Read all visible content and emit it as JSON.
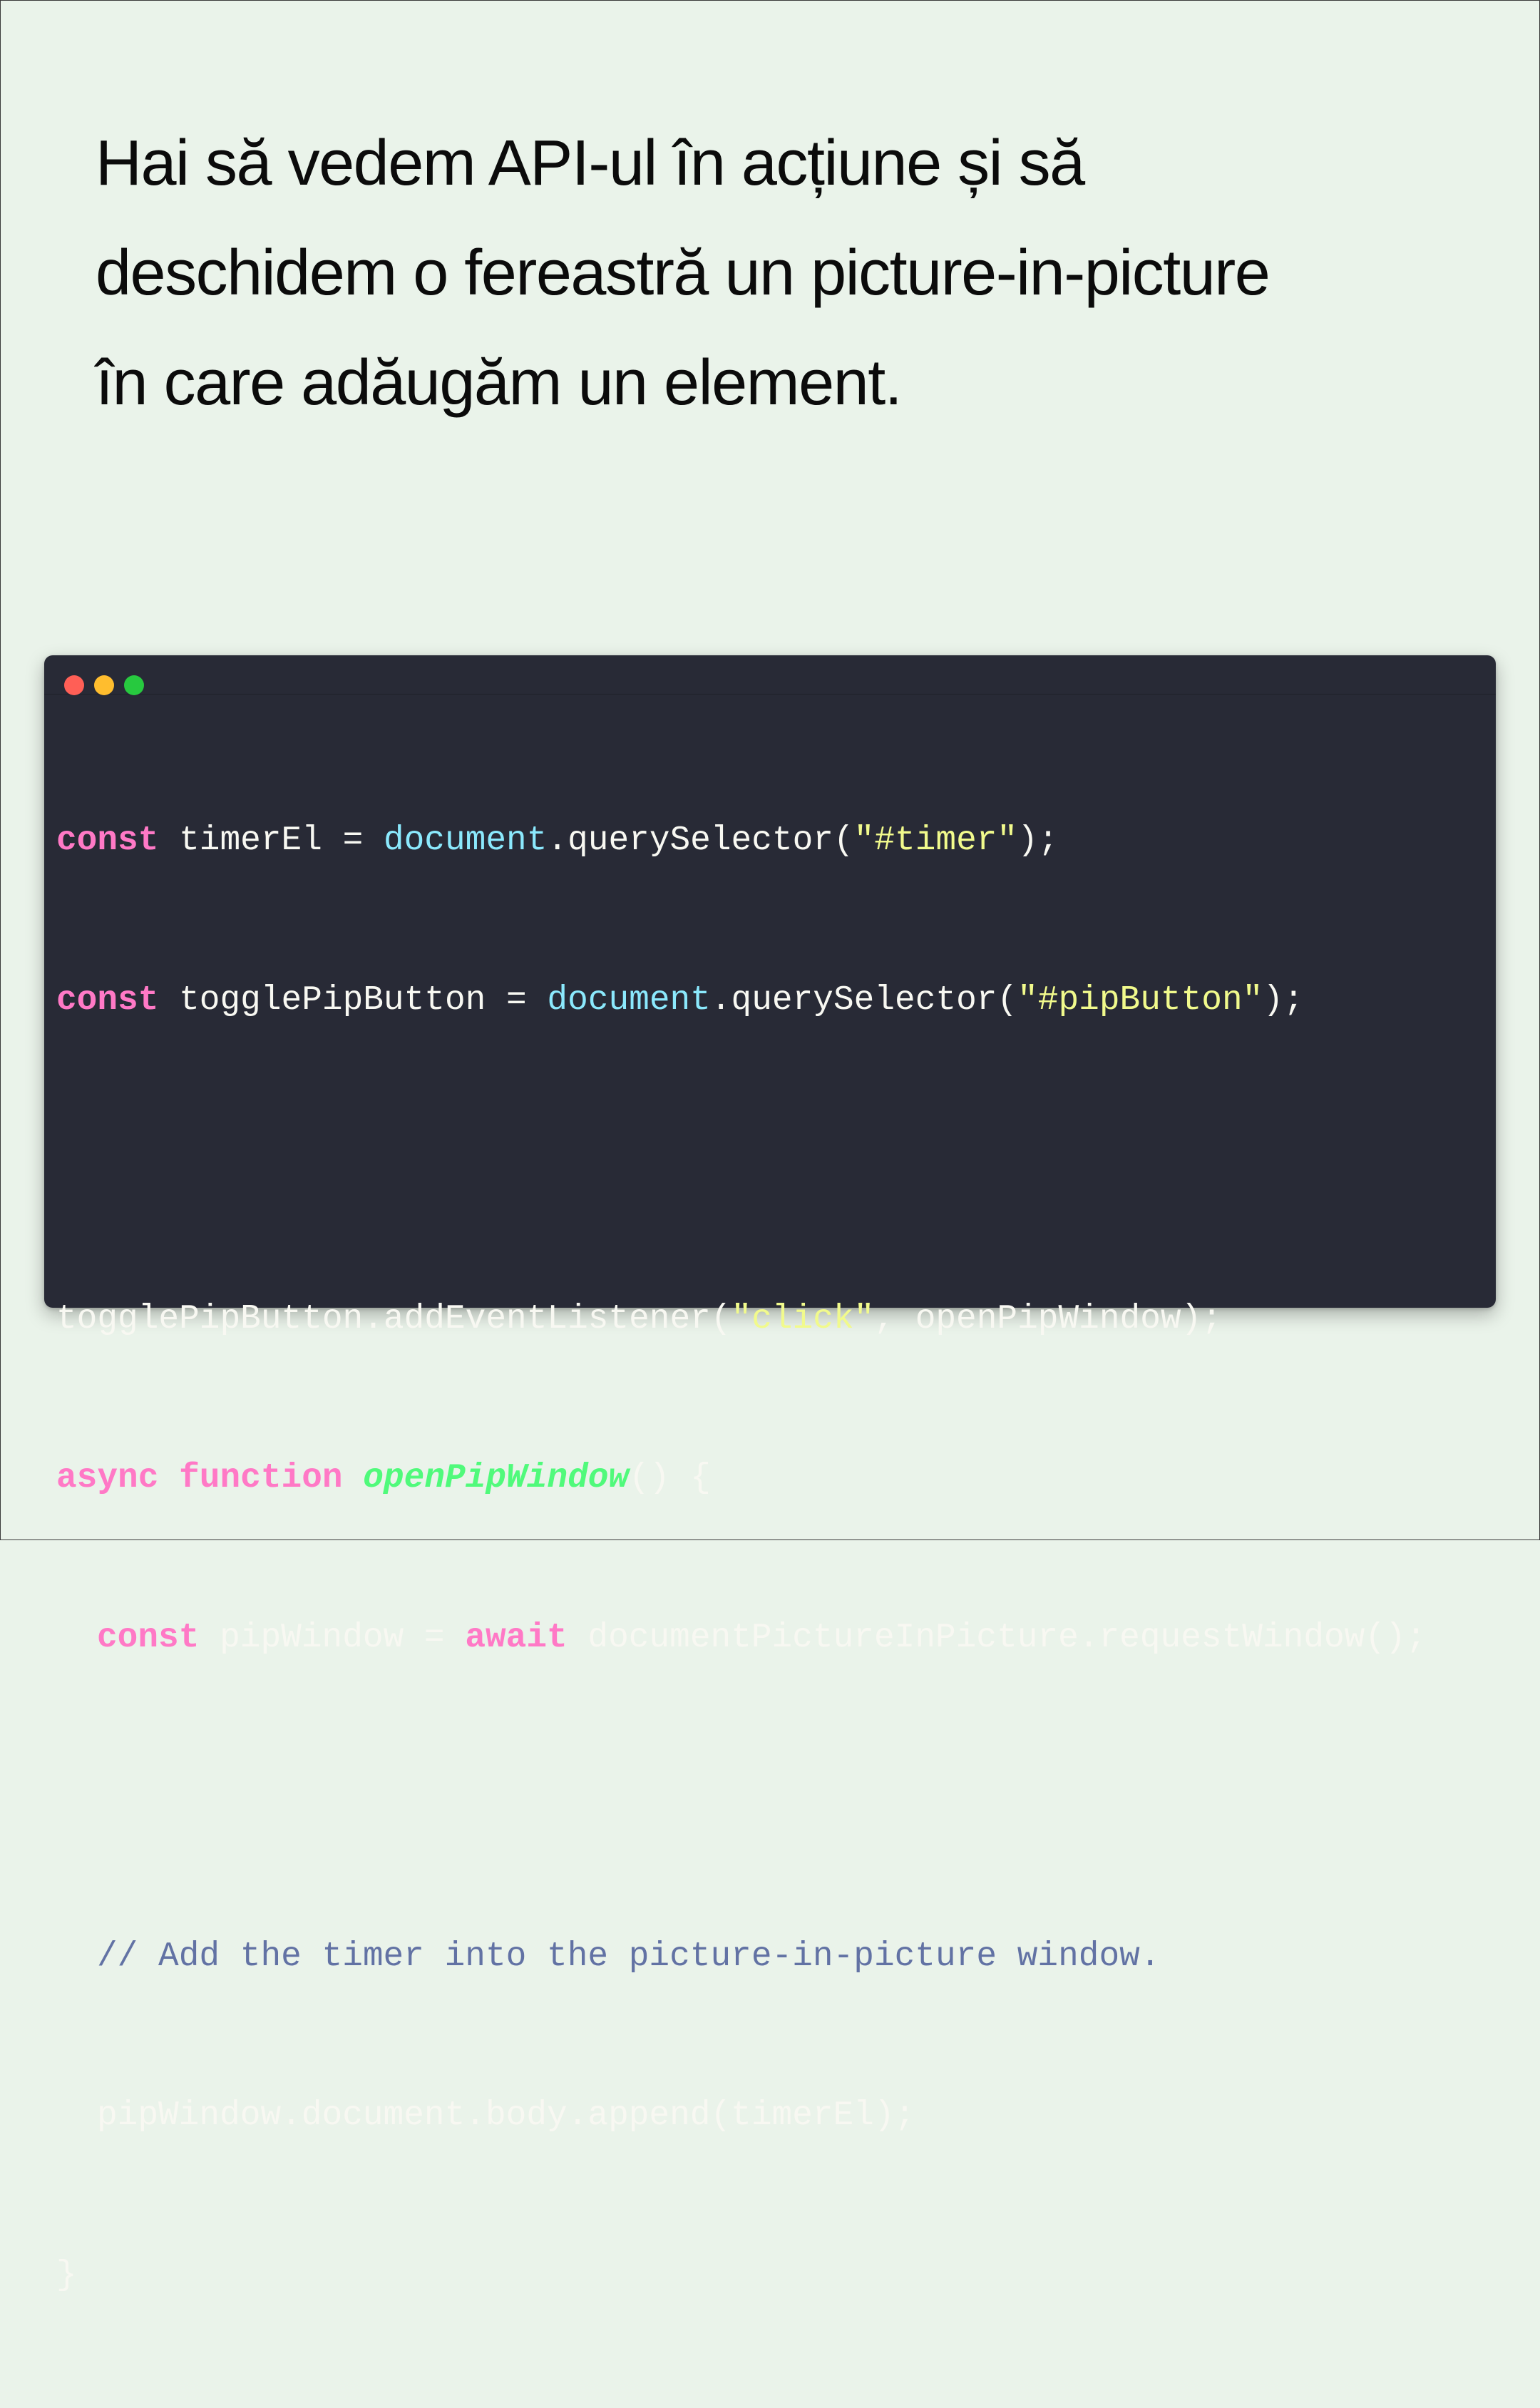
{
  "intro": {
    "lines": [
      "Hai să vedem API-ul în acțiune și să",
      "deschidem o fereastră un picture-in-picture",
      "în care adăugăm un element."
    ]
  },
  "code_window": {
    "colors": {
      "background": "#282a36",
      "close_dot": "#ff5f56",
      "minimize_dot": "#ffbd2e",
      "maximize_dot": "#27c93f",
      "keyword": "#ff79c6",
      "builtin": "#8be9fd",
      "string": "#f1fa8c",
      "function_name": "#50fa7b",
      "comment": "#6272a4"
    },
    "code": {
      "l1": {
        "kw": "const",
        "a": " timerEl = ",
        "builtin": "document",
        "b": ".querySelector(",
        "str": "\"#timer\"",
        "c": ");"
      },
      "l2": {
        "kw": "const",
        "a": " togglePipButton = ",
        "builtin": "document",
        "b": ".querySelector(",
        "str": "\"#pipButton\"",
        "c": ");"
      },
      "l4": {
        "a": "togglePipButton.addEventListener(",
        "str": "\"click\"",
        "b": ", openPipWindow);"
      },
      "l5": {
        "kw1": "async",
        "sp": " ",
        "kw2": "function",
        "sp2": " ",
        "fn": "openPipWindow",
        "a": "() {"
      },
      "l6": {
        "kw1": "const",
        "a": " pipWindow = ",
        "kw2": "await",
        "b": " documentPictureInPicture.requestWindow();"
      },
      "l8": {
        "cmt": "// Add the timer into the picture-in-picture window."
      },
      "l9": {
        "a": "pipWindow.document.body.append(timerEl);"
      },
      "l10": {
        "a": "}"
      }
    }
  }
}
